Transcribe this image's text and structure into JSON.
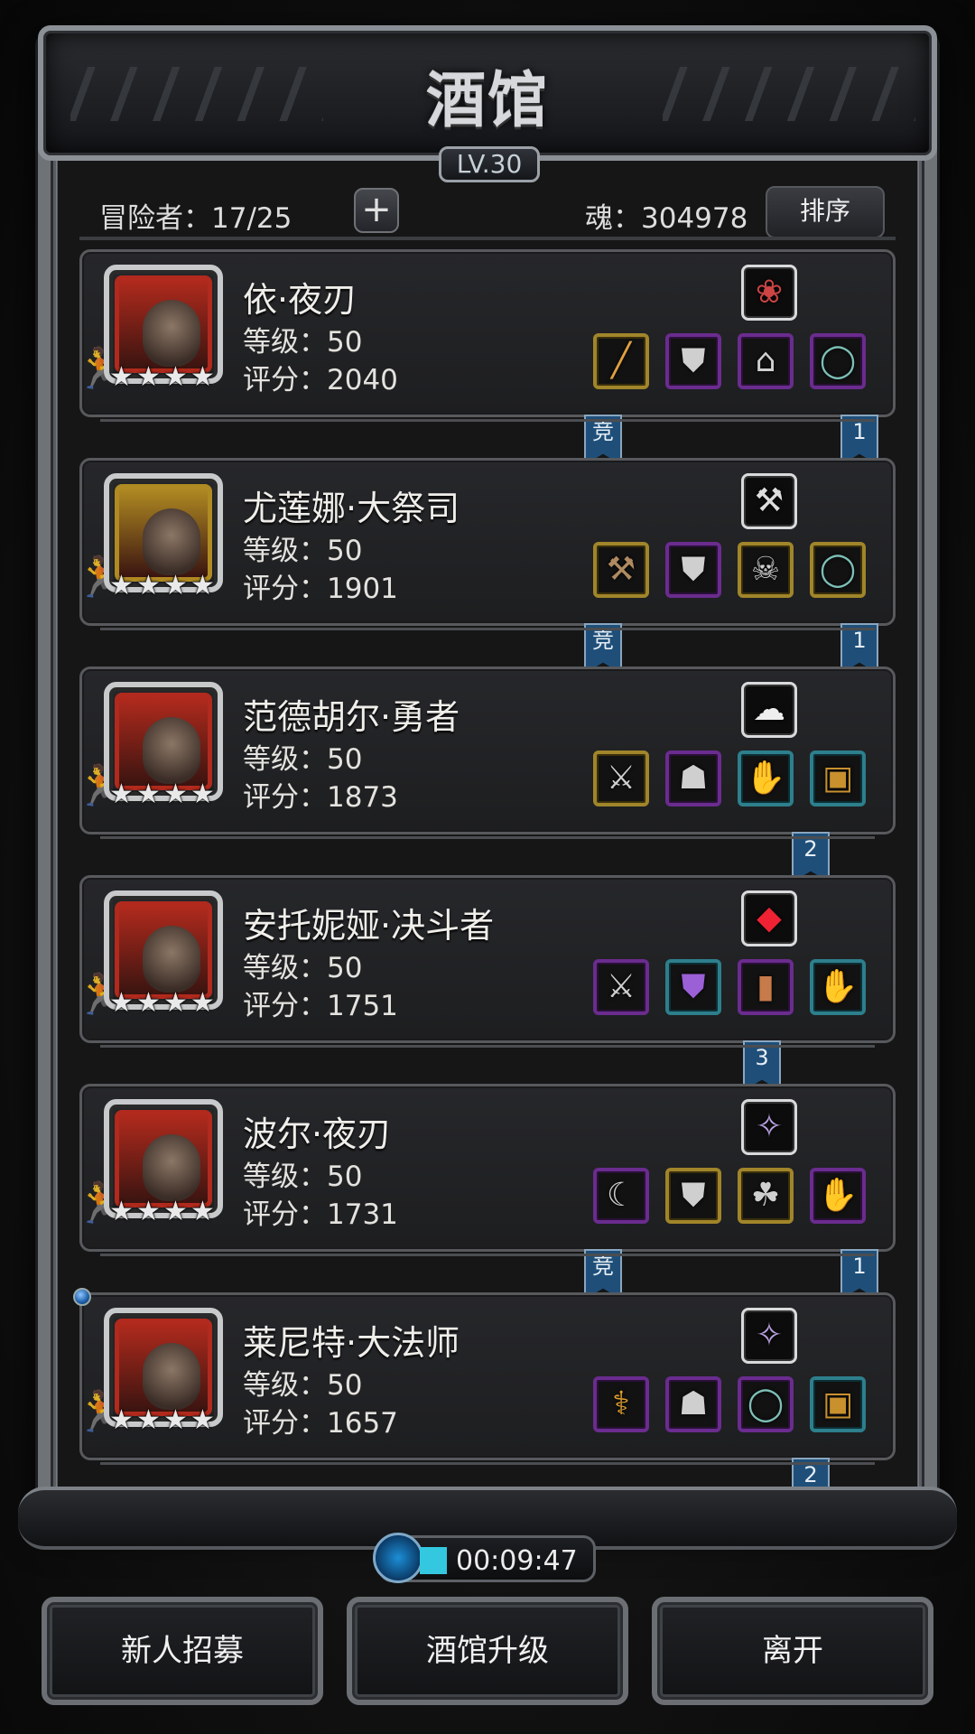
{
  "header": {
    "title": "酒馆",
    "level": "LV.30"
  },
  "info": {
    "adventurers": "冒险者：17/25",
    "plus": "+",
    "soul": "魂：304978",
    "sort_label": "排序"
  },
  "heroes": [
    {
      "name": "依·夜刃",
      "level": "等级：50",
      "score": "评分：2040",
      "frame": "#b12a1d",
      "special_icon": "red-horn-icon",
      "equipment": [
        {
          "icon": "spear-icon",
          "rarity": "gold"
        },
        {
          "icon": "armor-icon",
          "rarity": "purple"
        },
        {
          "icon": "helmet-icon",
          "rarity": "purple"
        },
        {
          "icon": "ring-icon",
          "rarity": "purple"
        }
      ],
      "ribbons": [
        {
          "text": "竞",
          "pos": "left"
        },
        {
          "text": "1",
          "pos": "right"
        }
      ]
    },
    {
      "name": "尤莲娜·大祭司",
      "level": "等级：50",
      "score": "评分：1901",
      "frame": "#b08a22",
      "special_icon": "bracer-icon",
      "equipment": [
        {
          "icon": "hammer-icon",
          "rarity": "gold"
        },
        {
          "icon": "armor-icon",
          "rarity": "purple"
        },
        {
          "icon": "skull-mask-icon",
          "rarity": "gold"
        },
        {
          "icon": "ring-icon",
          "rarity": "gold"
        }
      ],
      "ribbons": [
        {
          "text": "竞",
          "pos": "left"
        },
        {
          "text": "1",
          "pos": "right"
        }
      ]
    },
    {
      "name": "范德胡尔·勇者",
      "level": "等级：50",
      "score": "评分：1873",
      "frame": "#b12a1d",
      "special_icon": "feather-icon",
      "equipment": [
        {
          "icon": "axe-icon",
          "rarity": "gold"
        },
        {
          "icon": "cloak-icon",
          "rarity": "purple"
        },
        {
          "icon": "gauntlet-icon",
          "rarity": "teal"
        },
        {
          "icon": "chest-icon",
          "rarity": "teal"
        }
      ],
      "ribbons": [
        {
          "text": "2",
          "pos": "right"
        }
      ]
    },
    {
      "name": "安托妮娅·决斗者",
      "level": "等级：50",
      "score": "评分：1751",
      "frame": "#b12a1d",
      "special_icon": "red-gem-icon",
      "equipment": [
        {
          "icon": "sword-icon",
          "rarity": "purple"
        },
        {
          "icon": "purple-armor-icon",
          "rarity": "teal"
        },
        {
          "icon": "shield-plank-icon",
          "rarity": "purple"
        },
        {
          "icon": "gauntlet-icon",
          "rarity": "teal"
        }
      ],
      "ribbons": [
        {
          "text": "3",
          "pos": "right-mid"
        }
      ]
    },
    {
      "name": "波尔·夜刃",
      "level": "等级：50",
      "score": "评分：1731",
      "frame": "#b12a1d",
      "special_icon": "crystal-icon",
      "equipment": [
        {
          "icon": "curved-blade-icon",
          "rarity": "purple"
        },
        {
          "icon": "armor-icon",
          "rarity": "gold"
        },
        {
          "icon": "necklace-icon",
          "rarity": "gold"
        },
        {
          "icon": "gauntlet-icon",
          "rarity": "purple"
        }
      ],
      "ribbons": [
        {
          "text": "竞",
          "pos": "left"
        },
        {
          "text": "1",
          "pos": "right"
        }
      ]
    },
    {
      "name": "莱尼特·大法师",
      "level": "等级：50",
      "score": "评分：1657",
      "frame": "#b12a1d",
      "special_icon": "crystal-icon",
      "equipment": [
        {
          "icon": "staff-icon",
          "rarity": "purple"
        },
        {
          "icon": "cloak-icon",
          "rarity": "purple"
        },
        {
          "icon": "ring-icon",
          "rarity": "purple"
        },
        {
          "icon": "chest-icon",
          "rarity": "teal"
        }
      ],
      "ribbons": [
        {
          "text": "2",
          "pos": "right"
        }
      ]
    }
  ],
  "timer": "00:09:47",
  "buttons": {
    "recruit": "新人招募",
    "upgrade": "酒馆升级",
    "leave": "离开"
  }
}
